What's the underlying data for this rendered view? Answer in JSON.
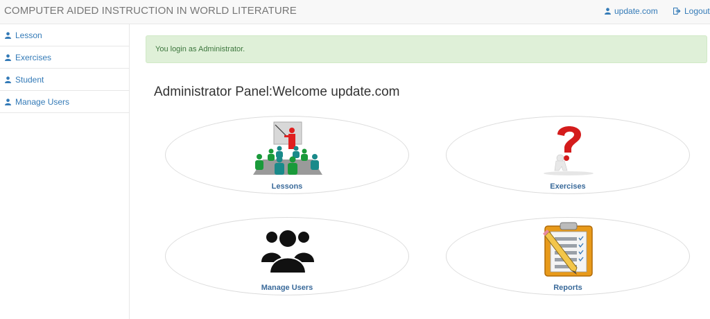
{
  "header": {
    "title": "COMPUTER AIDED INSTRUCTION IN WORLD LITERATURE",
    "user_link": "update.com",
    "logout_link": "Logout"
  },
  "sidebar": {
    "items": [
      {
        "label": "Lesson",
        "icon": "user-icon"
      },
      {
        "label": "Exercises",
        "icon": "user-icon"
      },
      {
        "label": "Student",
        "icon": "user-icon"
      },
      {
        "label": "Manage Users",
        "icon": "user-icon"
      }
    ]
  },
  "main": {
    "alert": "You login as Administrator.",
    "panel_title": "Administrator Panel:Welcome update.com",
    "tiles": [
      {
        "label": "Lessons",
        "icon": "lesson-classroom-icon"
      },
      {
        "label": "Exercises",
        "icon": "question-mark-figure-icon"
      },
      {
        "label": "Manage Users",
        "icon": "users-group-icon"
      },
      {
        "label": "Reports",
        "icon": "clipboard-report-icon"
      }
    ]
  },
  "colors": {
    "link": "#337ab7",
    "alert_bg": "#dff0d8",
    "alert_text": "#3c763d",
    "tile_label": "#3a6a9a"
  }
}
